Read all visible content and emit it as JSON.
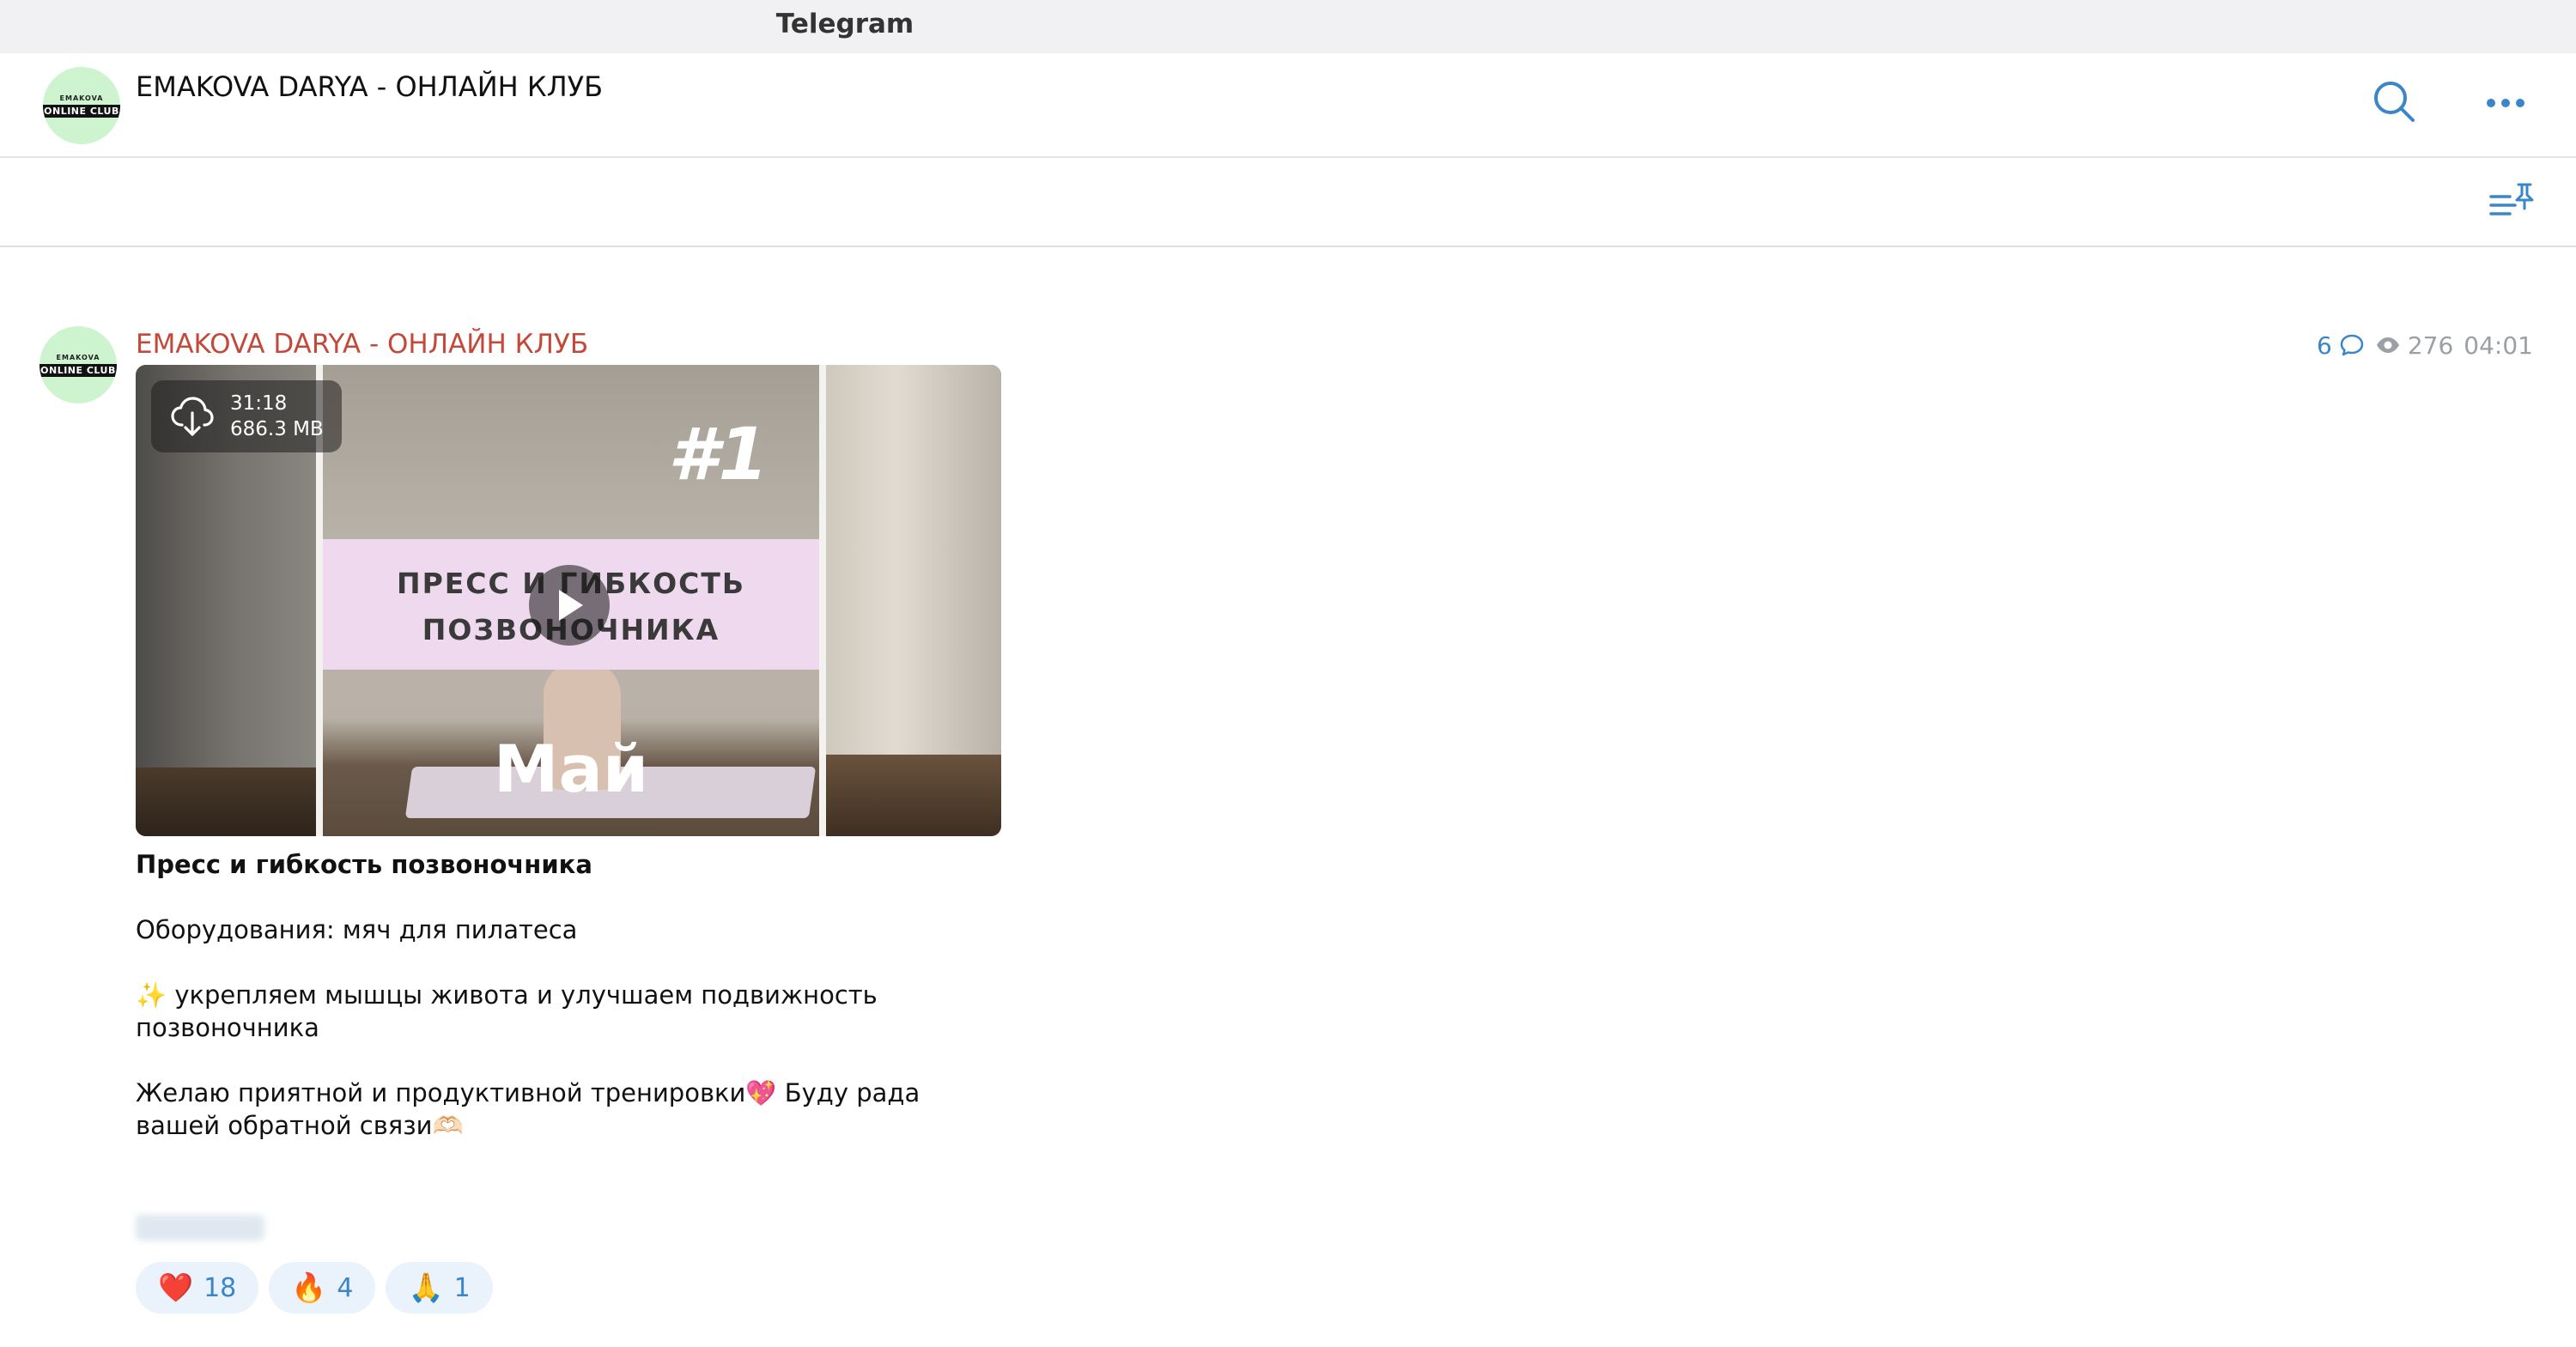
{
  "window": {
    "title": "Telegram"
  },
  "chat": {
    "name": "EMAKOVA DARYA - ОНЛАЙН КЛУБ",
    "avatar_top": "EMAKOVA",
    "avatar_tag": "ONLINE CLUB"
  },
  "icons": {
    "search": "search-icon",
    "more": "more-icon",
    "pinned": "pinned-messages-icon",
    "download": "download-icon",
    "play": "play-icon",
    "comments": "comment-icon",
    "views": "eye-icon"
  },
  "message": {
    "author": "EMAKOVA DARYA - ОНЛАЙН КЛУБ",
    "replies": "6",
    "views": "276",
    "time": "04:01",
    "video": {
      "duration": "31:18",
      "size": "686.3 MB",
      "thumb_number": "#1",
      "thumb_line1": "ПРЕСС И ГИБКОСТЬ",
      "thumb_line2": "ПОЗВОНОЧНИКА",
      "thumb_month": "Май"
    },
    "title": "Пресс и гибкость позвоночника",
    "equipment": "Оборудования: мяч для пилатеса",
    "benefit": "✨ укрепляем мышцы живота и улучшаем подвижность позвоночника",
    "wish": "Желаю приятной и продуктивной тренировки💖 Буду рада вашей обратной связи🫶🏻",
    "reactions": [
      {
        "emoji": "❤️",
        "count": "18"
      },
      {
        "emoji": "🔥",
        "count": "4"
      },
      {
        "emoji": "🙏",
        "count": "1"
      }
    ]
  },
  "colors": {
    "author": "#c3493b",
    "accent": "#3a86c8",
    "reaction_bg": "#eaf2fb",
    "avatar_bg": "#cdf3cf"
  }
}
